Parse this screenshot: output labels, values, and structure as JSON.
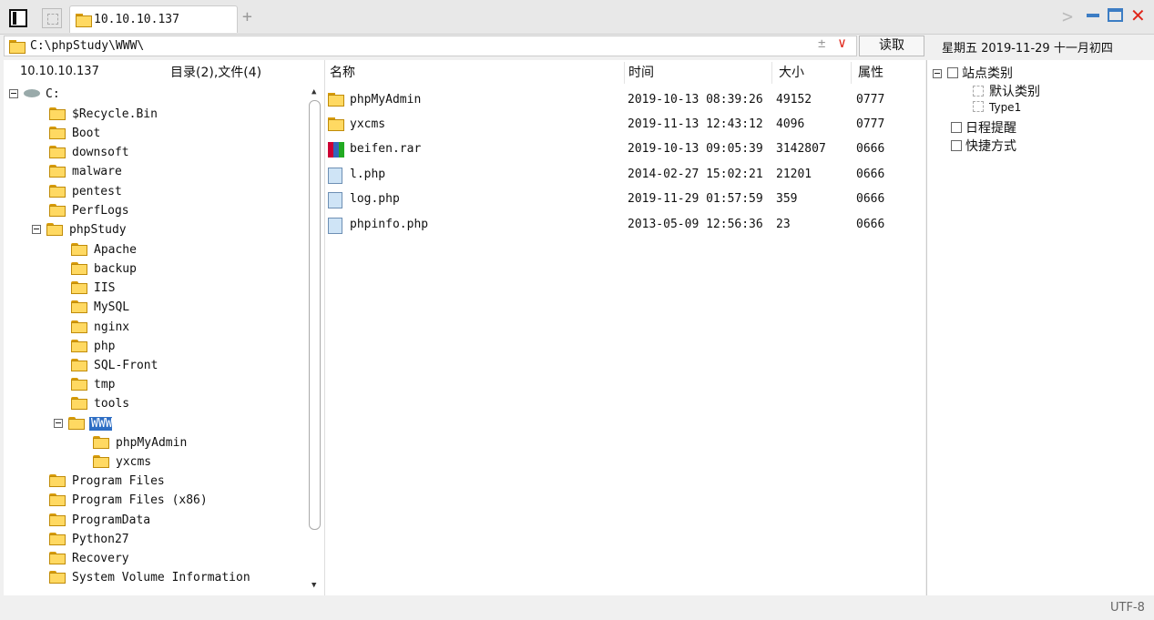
{
  "tabs": {
    "active_label": "10.10.10.137",
    "add_label": "+"
  },
  "window": {
    "forward_icon": "chevron-right-icon",
    "minimize_icon": "minimize-icon",
    "maximize_icon": "maximize-icon",
    "close_label": "✕"
  },
  "address": {
    "path": "C:\\phpStudy\\WWW\\",
    "plus_label": "±",
    "dropdown_label": "∨",
    "read_button": "读取"
  },
  "date_text": "星期五 2019-11-29 十一月初四",
  "left_header": {
    "host": "10.10.10.137",
    "summary": "目录(2),文件(4)"
  },
  "tree": {
    "drive": "C:",
    "items": [
      "$Recycle.Bin",
      "Boot",
      "downsoft",
      "malware",
      "pentest",
      "PerfLogs",
      "phpStudy",
      "Apache",
      "backup",
      "IIS",
      "MySQL",
      "nginx",
      "php",
      "SQL-Front",
      "tmp",
      "tools",
      "WWW",
      "phpMyAdmin",
      "yxcms",
      "Program Files",
      "Program Files (x86)",
      "ProgramData",
      "Python27",
      "Recovery",
      "System Volume Information"
    ]
  },
  "file_headers": {
    "name": "名称",
    "time": "时间",
    "size": "大小",
    "attr": "属性"
  },
  "files": [
    {
      "name": "phpMyAdmin",
      "time": "2019-10-13 08:39:26",
      "size": "49152",
      "attr": "0777",
      "icon": "folder-icon"
    },
    {
      "name": "yxcms",
      "time": "2019-11-13 12:43:12",
      "size": "4096",
      "attr": "0777",
      "icon": "folder-icon"
    },
    {
      "name": "beifen.rar",
      "time": "2019-10-13 09:05:39",
      "size": "3142807",
      "attr": "0666",
      "icon": "rar-archive-icon"
    },
    {
      "name": "l.php",
      "time": "2014-02-27 15:02:21",
      "size": "21201",
      "attr": "0666",
      "icon": "php-file-icon"
    },
    {
      "name": "log.php",
      "time": "2019-11-29 01:57:59",
      "size": "359",
      "attr": "0666",
      "icon": "php-file-icon"
    },
    {
      "name": "phpinfo.php",
      "time": "2013-05-09 12:56:36",
      "size": "23",
      "attr": "0666",
      "icon": "php-file-icon"
    }
  ],
  "right_tree": {
    "site_category": "站点类别",
    "default_category": "默认类别",
    "type1": "Type1",
    "schedule": "日程提醒",
    "shortcuts": "快捷方式"
  },
  "status": {
    "encoding": "UTF-8"
  },
  "colors": {
    "selection": "#2e6ec4",
    "close": "#e0261a",
    "window_buttons": "#3c7dc4"
  }
}
